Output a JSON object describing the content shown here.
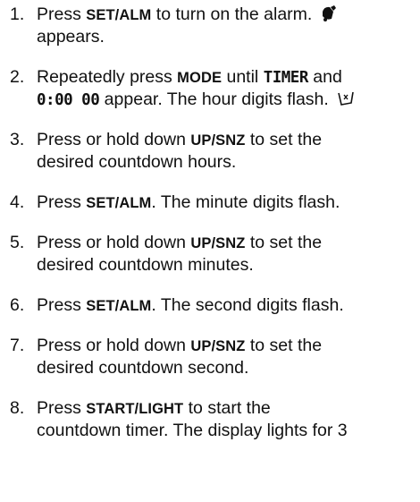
{
  "steps": [
    {
      "num": "1.",
      "line1": {
        "a": "Press ",
        "k1": "SET/ALM",
        "b": " to turn on the alarm. "
      },
      "line2": "appears."
    },
    {
      "num": "2.",
      "line1": {
        "a": "Repeatedly press ",
        "k1": "MODE",
        "b": " until ",
        "lcd1": "TIMER",
        "c": " and"
      },
      "line2": {
        "lcd2": "0:00 00",
        "a": " appear. The hour digits flash. "
      }
    },
    {
      "num": "3.",
      "line1": {
        "a": "Press or hold down ",
        "k1": "UP/SNZ",
        "b": " to set the"
      },
      "line2": "desired countdown hours."
    },
    {
      "num": "4.",
      "line1": {
        "a": "Press ",
        "k1": "SET/ALM",
        "b": ". The minute digits flash."
      }
    },
    {
      "num": "5.",
      "line1": {
        "a": "Press or hold down ",
        "k1": "UP/SNZ",
        "b": " to set the"
      },
      "line2": "desired countdown minutes."
    },
    {
      "num": "6.",
      "line1": {
        "a": "Press ",
        "k1": "SET/ALM",
        "b": ". The second digits flash."
      }
    },
    {
      "num": "7.",
      "line1": {
        "a": "Press or hold down ",
        "k1": "UP/SNZ",
        "b": " to set the"
      },
      "line2": "desired countdown second."
    },
    {
      "num": "8.",
      "line1": {
        "a": "Press ",
        "k1": "START/LIGHT",
        "b": " to start the"
      },
      "line2": "countdown timer. The display lights for 3"
    }
  ],
  "icons": {
    "alarm": "alarm-bell-icon",
    "flash": "flash-digits-icon"
  }
}
